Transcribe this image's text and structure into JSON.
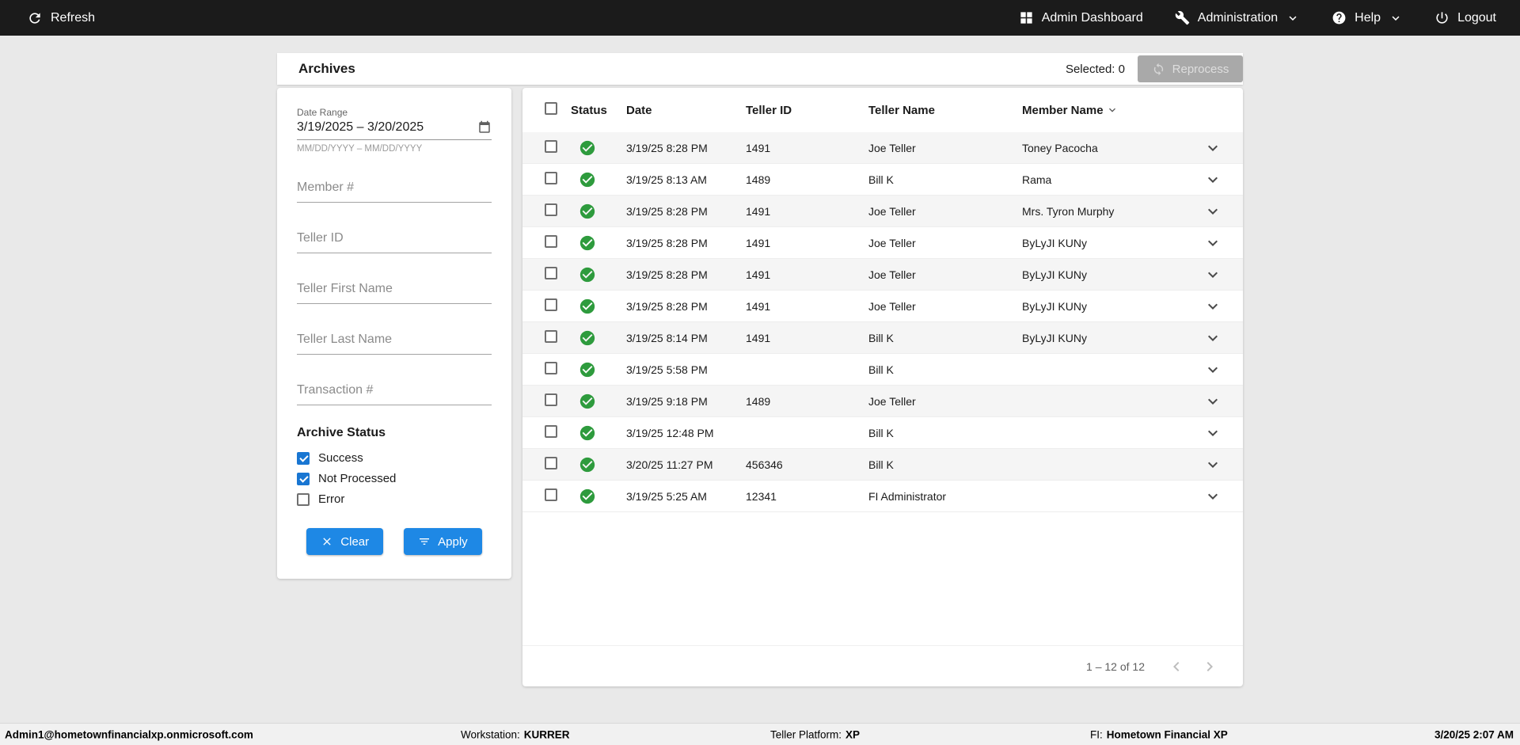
{
  "colors": {
    "accent": "#1e88e5",
    "checkbox": "#1976d2",
    "success": "#2e9b3d",
    "topbar_bg": "#1b1b1b",
    "disabled_bg": "#a9a9a9",
    "stripe": "#f5f5f5"
  },
  "topbar": {
    "refresh_label": "Refresh",
    "admin_dashboard_label": "Admin Dashboard",
    "administration_label": "Administration",
    "help_label": "Help",
    "logout_label": "Logout"
  },
  "header": {
    "title": "Archives",
    "selected_label": "Selected: 0",
    "reprocess_label": "Reprocess"
  },
  "filters": {
    "date_range": {
      "label": "Date Range",
      "value": "3/19/2025 – 3/20/2025",
      "helper": "MM/DD/YYYY – MM/DD/YYYY"
    },
    "member_number_placeholder": "Member #",
    "teller_id_placeholder": "Teller ID",
    "teller_first_name_placeholder": "Teller First Name",
    "teller_last_name_placeholder": "Teller Last Name",
    "transaction_number_placeholder": "Transaction #",
    "archive_status": {
      "label": "Archive Status",
      "options": [
        {
          "label": "Success",
          "checked": true
        },
        {
          "label": "Not Processed",
          "checked": true
        },
        {
          "label": "Error",
          "checked": false
        }
      ]
    },
    "clear_label": "Clear",
    "apply_label": "Apply"
  },
  "table": {
    "columns": [
      "Status",
      "Date",
      "Teller ID",
      "Teller Name",
      "Member Name"
    ],
    "sort_column": "Member Name",
    "rows": [
      {
        "status": "success",
        "date": "3/19/25 8:28 PM",
        "teller_id": "1491",
        "teller_name": "Joe Teller",
        "member_name": "Toney Pacocha"
      },
      {
        "status": "success",
        "date": "3/19/25 8:13 AM",
        "teller_id": "1489",
        "teller_name": "Bill K",
        "member_name": "Rama"
      },
      {
        "status": "success",
        "date": "3/19/25 8:28 PM",
        "teller_id": "1491",
        "teller_name": "Joe Teller",
        "member_name": "Mrs. Tyron Murphy"
      },
      {
        "status": "success",
        "date": "3/19/25 8:28 PM",
        "teller_id": "1491",
        "teller_name": "Joe Teller",
        "member_name": "ByLyJI KUNy"
      },
      {
        "status": "success",
        "date": "3/19/25 8:28 PM",
        "teller_id": "1491",
        "teller_name": "Joe Teller",
        "member_name": "ByLyJI KUNy"
      },
      {
        "status": "success",
        "date": "3/19/25 8:28 PM",
        "teller_id": "1491",
        "teller_name": "Joe Teller",
        "member_name": "ByLyJI KUNy"
      },
      {
        "status": "success",
        "date": "3/19/25 8:14 PM",
        "teller_id": "1491",
        "teller_name": "Bill K",
        "member_name": "ByLyJI KUNy"
      },
      {
        "status": "success",
        "date": "3/19/25 5:58 PM",
        "teller_id": "",
        "teller_name": "Bill K",
        "member_name": ""
      },
      {
        "status": "success",
        "date": "3/19/25 9:18 PM",
        "teller_id": "1489",
        "teller_name": "Joe Teller",
        "member_name": ""
      },
      {
        "status": "success",
        "date": "3/19/25 12:48 PM",
        "teller_id": "",
        "teller_name": "Bill K",
        "member_name": ""
      },
      {
        "status": "success",
        "date": "3/20/25 11:27 PM",
        "teller_id": "456346",
        "teller_name": "Bill K",
        "member_name": ""
      },
      {
        "status": "success",
        "date": "3/19/25 5:25 AM",
        "teller_id": "12341",
        "teller_name": "FI Administrator",
        "member_name": ""
      }
    ],
    "pagination": "1 – 12 of 12"
  },
  "statusbar": {
    "user": "Admin1@hometownfinancialxp.onmicrosoft.com",
    "workstation_label": "Workstation:",
    "workstation_value": "KURRER",
    "platform_label": "Teller Platform:",
    "platform_value": "XP",
    "fi_label": "FI:",
    "fi_value": "Hometown Financial XP",
    "datetime": "3/20/25 2:07 AM"
  }
}
